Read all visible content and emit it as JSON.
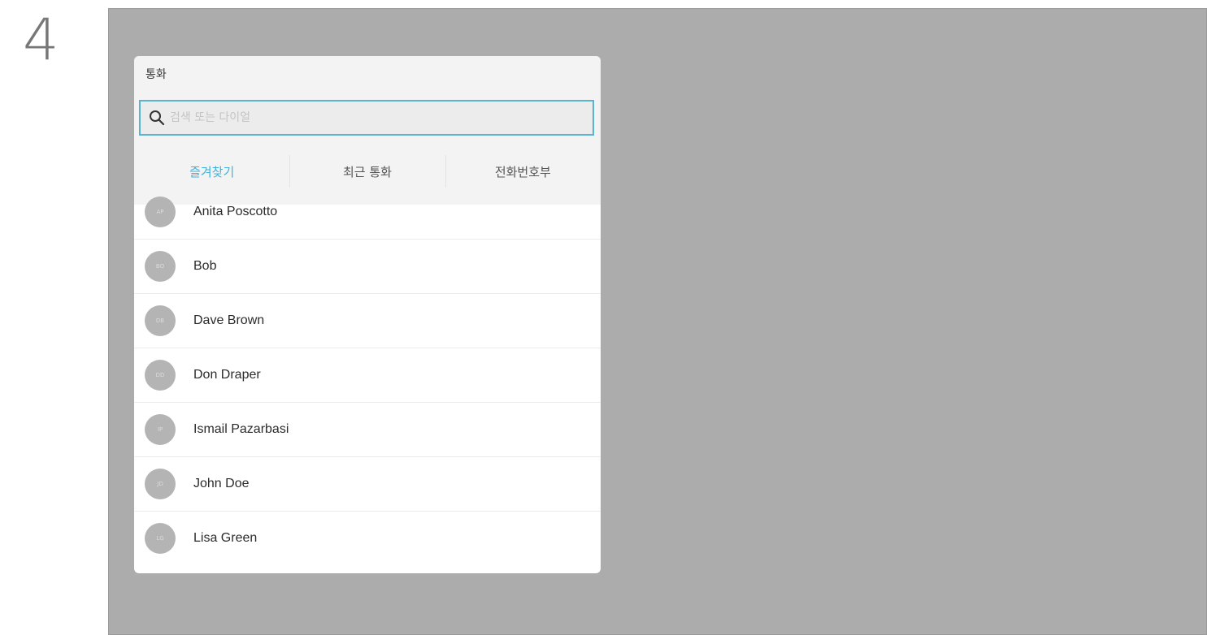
{
  "step_number": "4",
  "dialog": {
    "title": "통화",
    "search": {
      "value": "",
      "placeholder": "검색 또는 다이얼"
    },
    "tabs": [
      {
        "label": "즐겨찾기",
        "active": true
      },
      {
        "label": "최근 통화",
        "active": false
      },
      {
        "label": "전화번호부",
        "active": false
      }
    ],
    "contacts": [
      {
        "initials": "AP",
        "name": "Anita Poscotto"
      },
      {
        "initials": "BO",
        "name": "Bob"
      },
      {
        "initials": "DB",
        "name": "Dave Brown"
      },
      {
        "initials": "DD",
        "name": "Don Draper"
      },
      {
        "initials": "IP",
        "name": "Ismail Pazarbasi"
      },
      {
        "initials": "JD",
        "name": "John Doe"
      },
      {
        "initials": "LG",
        "name": "Lisa Green"
      }
    ]
  },
  "colors": {
    "accent": "#3fb2dc",
    "screen_background": "#acacac",
    "avatar": "#b4b4b4"
  },
  "icons": {
    "search": "search-icon"
  }
}
